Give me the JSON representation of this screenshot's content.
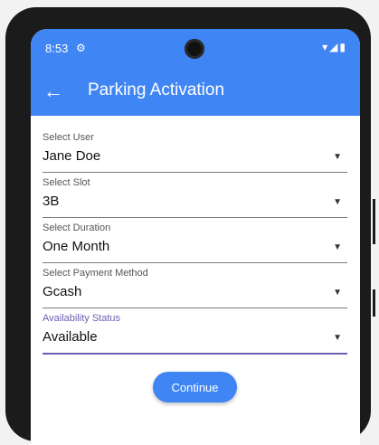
{
  "status_bar": {
    "time": "8:53",
    "gear_icon": "gear-icon",
    "system_icons": "▾◢▮"
  },
  "app_bar": {
    "back_icon": "←",
    "title": "Parking Activation"
  },
  "fields": {
    "user": {
      "label": "Select User",
      "value": "Jane Doe"
    },
    "slot": {
      "label": "Select Slot",
      "value": "3B"
    },
    "duration": {
      "label": "Select Duration",
      "value": "One Month"
    },
    "payment": {
      "label": "Select Payment Method",
      "value": "Gcash"
    },
    "availability": {
      "label": "Availability Status",
      "value": "Available"
    }
  },
  "dropdown_icon": "▼",
  "continue_label": "Continue",
  "colors": {
    "primary": "#3f86f4",
    "focus": "#6a5fb0"
  }
}
